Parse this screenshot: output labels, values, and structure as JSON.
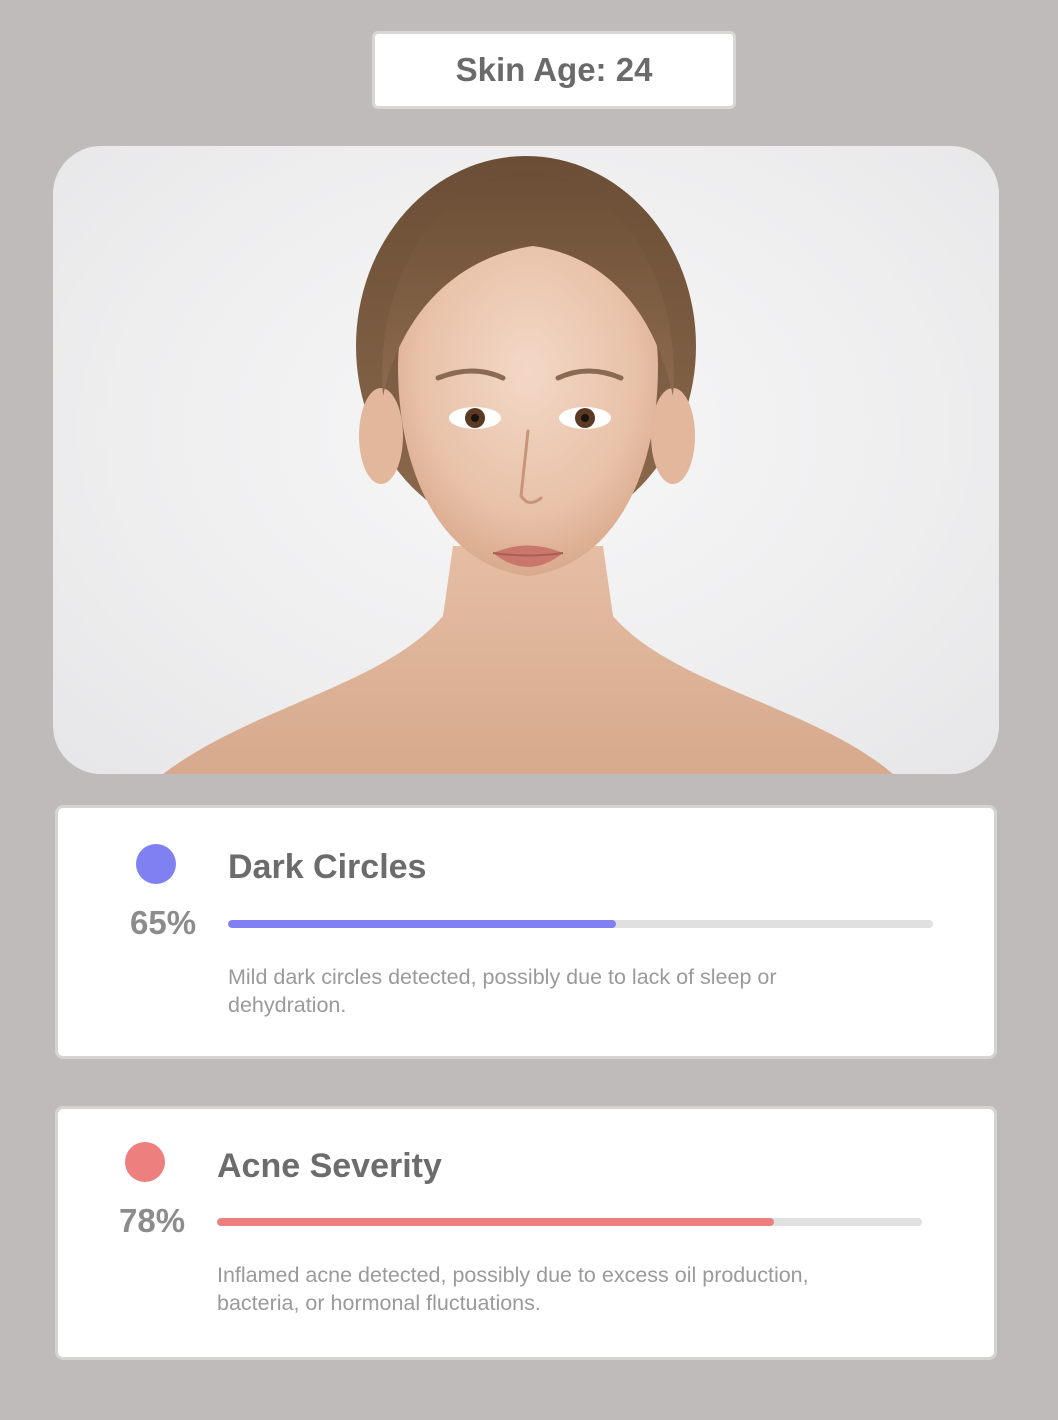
{
  "header": {
    "skin_age_label": "Skin Age: 24"
  },
  "photo": {
    "subject": "portrait-photo"
  },
  "metrics": [
    {
      "title": "Dark Circles",
      "percent_label": "65%",
      "bar_fill_fraction": 0.55,
      "color": "#8080f2",
      "description": "Mild dark circles detected, possibly due to lack of sleep or dehydration."
    },
    {
      "title": "Acne Severity",
      "percent_label": "78%",
      "bar_fill_fraction": 0.79,
      "color": "#ee7f7f",
      "description": "Inflamed acne detected, possibly due to excess oil production, bacteria, or hormonal fluctuations."
    }
  ]
}
